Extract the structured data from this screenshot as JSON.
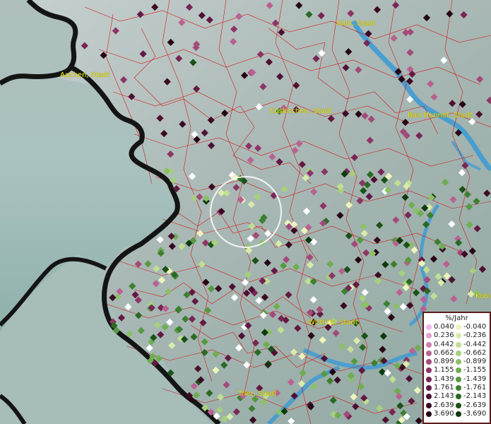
{
  "cities": [
    {
      "id": "koeln",
      "label": "Köln, Stadt"
    },
    {
      "id": "aachen",
      "label": "Aachen, Stadt"
    },
    {
      "id": "euskirchen",
      "label": "Euskirchen, Stadt"
    },
    {
      "id": "bad-honnef",
      "label": "Bad Honnef, Stadt"
    },
    {
      "id": "wittlich",
      "label": "Wittlich, Stadt"
    },
    {
      "id": "trier",
      "label": "Trier, Stadt"
    },
    {
      "id": "koblenz",
      "label": "Koble"
    }
  ],
  "legend": {
    "title": "%/Jahr",
    "rows": [
      {
        "pos": "0.040",
        "neg": "-0.040",
        "pos_color": "#f2b8e6",
        "neg_color": "#eef5bb"
      },
      {
        "pos": "0.236",
        "neg": "-0.236",
        "pos_color": "#e5a0cf",
        "neg_color": "#d8ecaa"
      },
      {
        "pos": "0.442",
        "neg": "-0.442",
        "pos_color": "#cf7fab",
        "neg_color": "#c0df92"
      },
      {
        "pos": "0.662",
        "neg": "-0.662",
        "pos_color": "#b96292",
        "neg_color": "#a6d07c"
      },
      {
        "pos": "0.899",
        "neg": "-0.899",
        "pos_color": "#a24a7a",
        "neg_color": "#8cc068"
      },
      {
        "pos": "1.155",
        "neg": "-1.155",
        "pos_color": "#8d3666",
        "neg_color": "#6fad52"
      },
      {
        "pos": "1.439",
        "neg": "-1.439",
        "pos_color": "#772655",
        "neg_color": "#559a40"
      },
      {
        "pos": "1.761",
        "neg": "-1.761",
        "pos_color": "#621a43",
        "neg_color": "#3d8030"
      },
      {
        "pos": "2.143",
        "neg": "-2.143",
        "pos_color": "#4e1133",
        "neg_color": "#2a6a24"
      },
      {
        "pos": "2.639",
        "neg": "-2.639",
        "pos_color": "#3a0a24",
        "neg_color": "#1a5218"
      },
      {
        "pos": "3.690",
        "neg": "-3.690",
        "pos_color": "#250515",
        "neg_color": "#0d3a0d"
      }
    ]
  }
}
